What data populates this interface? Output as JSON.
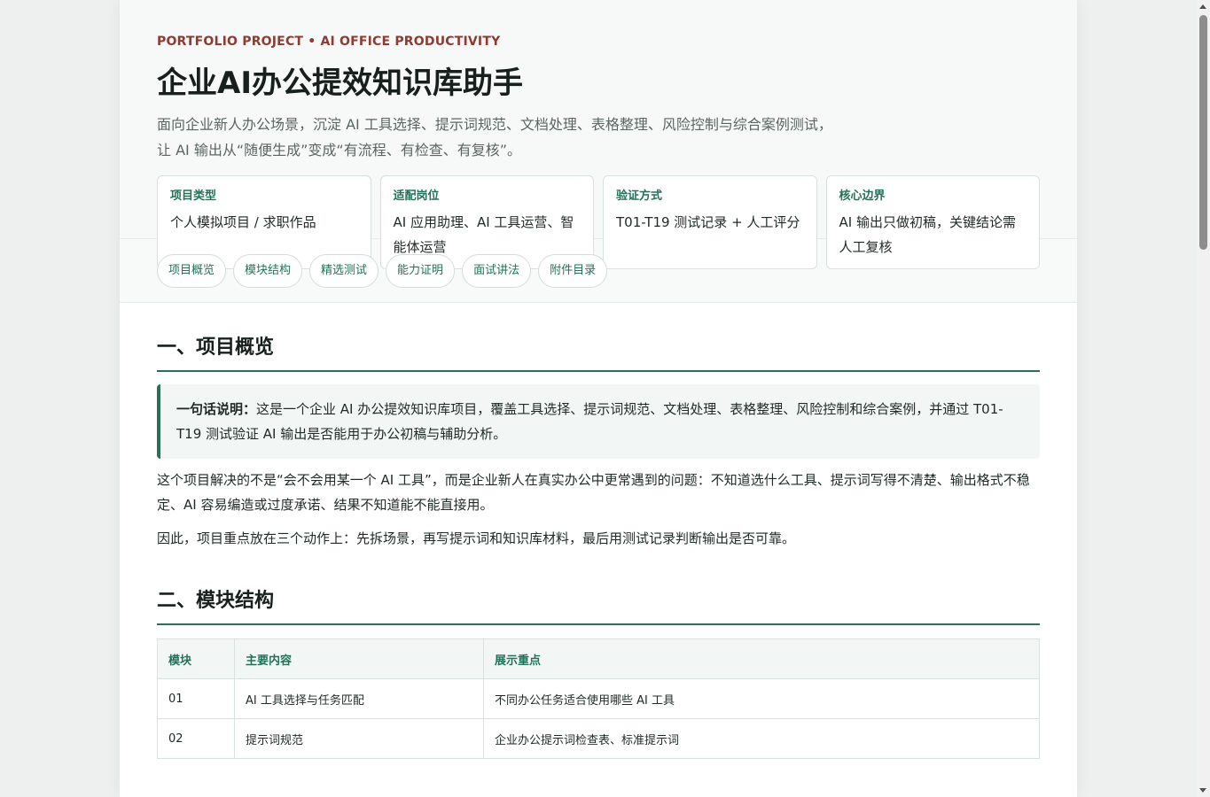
{
  "hero": {
    "eyebrow": "PORTFOLIO PROJECT • AI OFFICE PRODUCTIVITY",
    "title": "企业AI办公提效知识库助手",
    "subtitle_line1": "面向企业新人办公场景，沉淀 AI 工具选择、提示词规范、文档处理、表格整理、风险控制与综合案例测试，",
    "subtitle_line2": "让 AI 输出从“随便生成”变成“有流程、有检查、有复核”。",
    "cards": [
      {
        "label": "项目类型",
        "text": "个人模拟项目 / 求职作品"
      },
      {
        "label": "适配岗位",
        "text": "AI 应用助理、AI 工具运营、智能体运营"
      },
      {
        "label": "验证方式",
        "text": "T01-T19 测试记录 + 人工评分"
      },
      {
        "label": "核心边界",
        "text": "AI 输出只做初稿，关键结论需人工复核"
      }
    ]
  },
  "nav": {
    "items": [
      "项目概览",
      "模块结构",
      "精选测试",
      "能力证明",
      "面试讲法",
      "附件目录"
    ]
  },
  "section1": {
    "heading": "一、项目概览",
    "callout_label": "一句话说明：",
    "callout_text": "这是一个企业 AI 办公提效知识库项目，覆盖工具选择、提示词规范、文档处理、表格整理、风险控制和综合案例，并通过 T01-T19 测试验证 AI 输出是否能用于办公初稿与辅助分析。",
    "para1": "这个项目解决的不是“会不会用某一个 AI 工具”，而是企业新人在真实办公中更常遇到的问题：不知道选什么工具、提示词写得不清楚、输出格式不稳定、AI 容易编造或过度承诺、结果不知道能不能直接用。",
    "para2": "因此，项目重点放在三个动作上：先拆场景，再写提示词和知识库材料，最后用测试记录判断输出是否可靠。"
  },
  "section2": {
    "heading": "二、模块结构",
    "columns": [
      "模块",
      "主要内容",
      "展示重点"
    ],
    "rows": [
      [
        "01",
        "AI 工具选择与任务匹配",
        "不同办公任务适合使用哪些 AI 工具"
      ],
      [
        "02",
        "提示词规范",
        "企业办公提示词检查表、标准提示词"
      ]
    ]
  }
}
